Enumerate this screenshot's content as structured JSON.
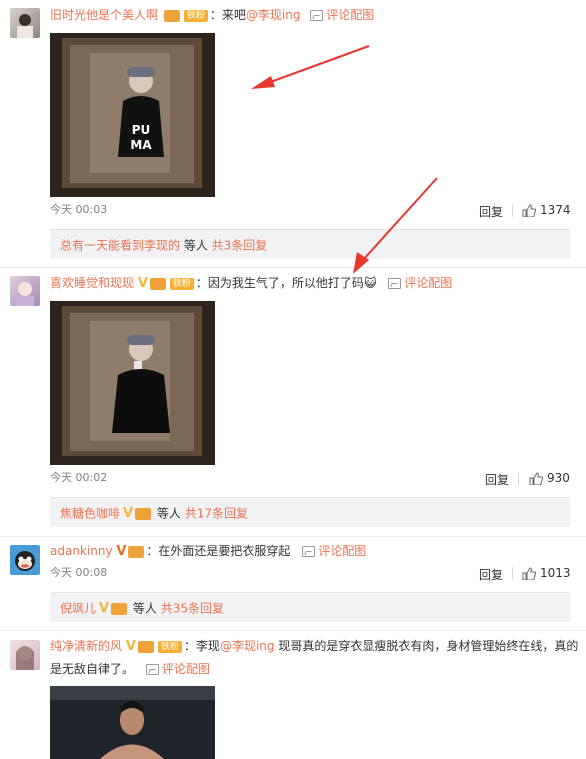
{
  "comments": [
    {
      "username": "旧时光他是个美人啊",
      "fan_badge": "铁粉",
      "text_before": "：来吧",
      "mention": "@李现ing",
      "pic_comment_label": "评论配图",
      "time": "今天 00:03",
      "reply_label": "回复",
      "likes": "1374",
      "replies_summary": {
        "prefix": "总有一天能看到李现的",
        "middle": " 等人 ",
        "count_link": "共3条回复"
      },
      "photo_text": "PU\nMA"
    },
    {
      "username": "喜欢睡觉和现现",
      "fan_badge": "铁粉",
      "text_before": "：因为我生气了，所以他打了码",
      "emoji": "😺",
      "pic_comment_label": "评论配图",
      "time": "今天 00:02",
      "reply_label": "回复",
      "likes": "930",
      "replies_summary": {
        "prefix": "焦糖色咖啡",
        "middle": " 等人 ",
        "count_link": "共17条回复"
      }
    },
    {
      "username": "adankinny",
      "text_before": "：在外面还是要把衣服穿起",
      "pic_comment_label": "评论配图",
      "time": "今天 00:08",
      "reply_label": "回复",
      "likes": "1013",
      "replies_summary": {
        "prefix": "倪飒儿",
        "middle": " 等人 ",
        "count_link": "共35条回复"
      }
    },
    {
      "username": "纯净清新的风",
      "fan_badge": "铁粉",
      "text_before": "：李现",
      "mention": "@李现ing",
      "text_after": " 现哥真的是穿衣显瘦脱衣有肉，身材管理始终在线，真的",
      "text_line2": "是无敌自律了。",
      "pic_comment_label": "评论配图"
    }
  ],
  "colors": {
    "username": "#eb7350",
    "arrow": "#e8372e",
    "reply_bg": "#f2f2f5"
  }
}
